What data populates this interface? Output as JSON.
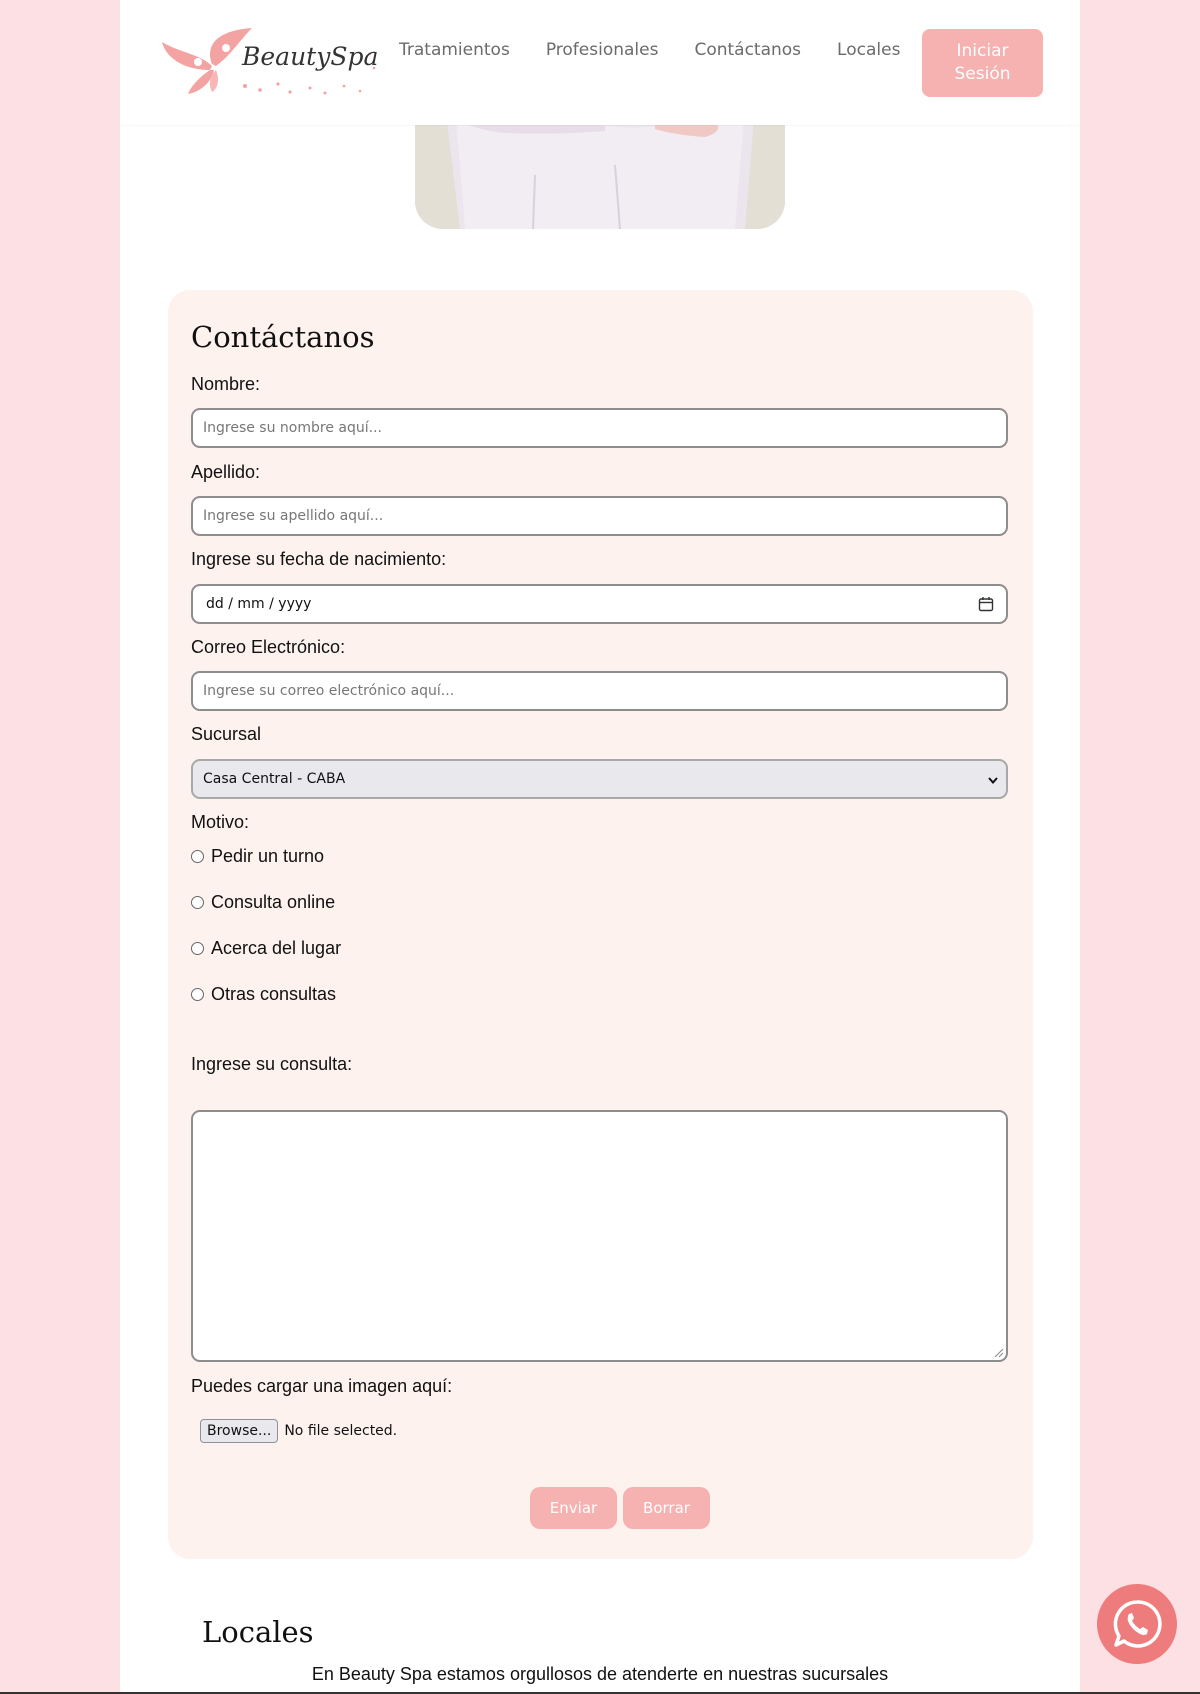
{
  "header": {
    "logo_text": "BeautySpa",
    "nav": [
      {
        "label": "Tratamientos"
      },
      {
        "label": "Profesionales"
      },
      {
        "label": "Contáctanos"
      },
      {
        "label": "Locales"
      }
    ],
    "login_label": "Iniciar Sesión"
  },
  "form": {
    "title": "Contáctanos",
    "nombre": {
      "label": "Nombre:",
      "placeholder": "Ingrese su nombre aquí..."
    },
    "apellido": {
      "label": "Apellido:",
      "placeholder": "Ingrese su apellido aquí..."
    },
    "fecha": {
      "label": "Ingrese su fecha de nacimiento:",
      "value": "dd / mm / yyyy"
    },
    "correo": {
      "label": "Correo Electrónico:",
      "placeholder": "Ingrese su correo electrónico aquí..."
    },
    "sucursal": {
      "label": "Sucursal",
      "selected": "Casa Central - CABA"
    },
    "motivo": {
      "label": "Motivo:",
      "options": [
        "Pedir un turno",
        "Consulta online",
        "Acerca del lugar",
        "Otras consultas"
      ]
    },
    "consulta": {
      "label": "Ingrese su consulta:"
    },
    "imagen": {
      "label": "Puedes cargar una imagen aquí:",
      "browse_label": "Browse...",
      "status": "No file selected."
    },
    "submit_label": "Enviar",
    "reset_label": "Borrar"
  },
  "locales": {
    "title": "Locales",
    "text": "En Beauty Spa estamos orgullosos de atenderte en nuestras sucursales"
  },
  "colors": {
    "background": "#fde0e3",
    "accent": "#f6b1b1",
    "card": "#fdf2ee",
    "whatsapp": "#ef7c7c"
  },
  "icons": {
    "logo": "butterfly-icon",
    "calendar": "calendar-icon",
    "select": "chevron-down-icon",
    "whatsapp": "whatsapp-icon"
  }
}
